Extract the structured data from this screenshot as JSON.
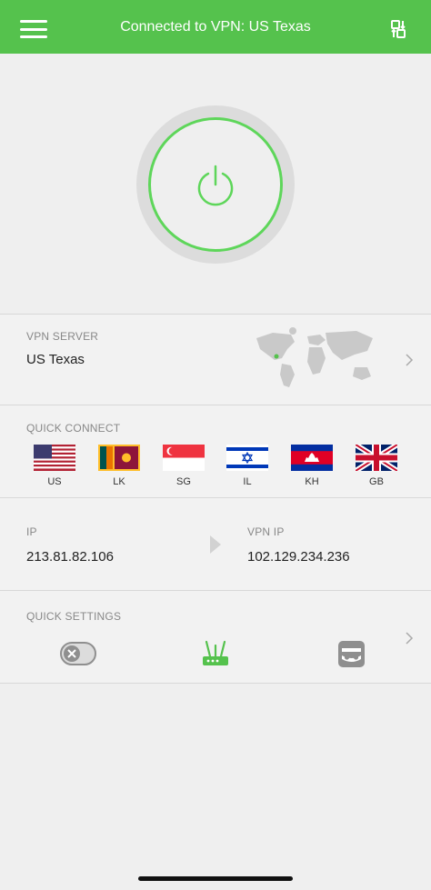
{
  "header": {
    "title": "Connected to VPN: US Texas",
    "menu_icon": "hamburger-icon",
    "action_icon": "switch-server-icon"
  },
  "colors": {
    "accent": "#55c24d",
    "power_ring": "#5ed65a",
    "background": "#efefef"
  },
  "vpn_server": {
    "label": "VPN SERVER",
    "value": "US Texas"
  },
  "quick_connect": {
    "label": "QUICK CONNECT",
    "items": [
      {
        "code": "US"
      },
      {
        "code": "LK"
      },
      {
        "code": "SG"
      },
      {
        "code": "IL"
      },
      {
        "code": "KH"
      },
      {
        "code": "GB"
      }
    ]
  },
  "ip_info": {
    "ip_label": "IP",
    "ip_value": "213.81.82.106",
    "vpn_ip_label": "VPN IP",
    "vpn_ip_value": "102.129.234.236"
  },
  "quick_settings": {
    "label": "QUICK SETTINGS",
    "icons": [
      "kill-switch-toggle-icon",
      "router-icon",
      "incognito-icon"
    ]
  }
}
